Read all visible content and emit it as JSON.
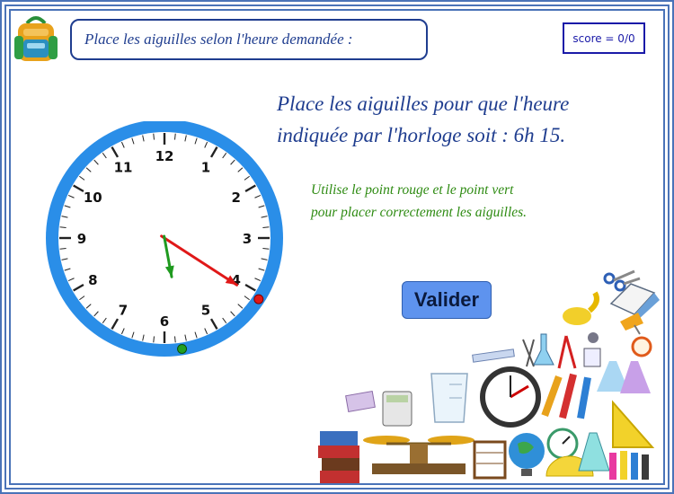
{
  "header": {
    "title": "Place les aiguilles selon l'heure demandée :",
    "score": "score = 0/0"
  },
  "task": {
    "instruction_line1": "Place les aiguilles pour que l'heure",
    "instruction_line2": "indiquée par l'horloge soit : 6h 15.",
    "hint_line1": "Utilise le point rouge et le point vert",
    "hint_line2": "pour placer correctement les aiguilles."
  },
  "validate_button": "Valider",
  "clock": {
    "numbers": [
      "12",
      "1",
      "2",
      "3",
      "4",
      "5",
      "6",
      "7",
      "8",
      "9",
      "10",
      "11"
    ],
    "hour_hand_time_hours": 5.65,
    "minute_hand_time_minutes": 20.5,
    "minute_handle_position_minutes": 20.5,
    "hour_handle_position_minutes": 28.5
  },
  "colors": {
    "frame": "#4a73b8",
    "title_text": "#1f3d8f",
    "score_border": "#1a1aa8",
    "hint_text": "#2e8b12",
    "button": "#5e93ee",
    "clock_ring": "#2a8ee8",
    "minute_hand": "#e01818",
    "hour_hand": "#1f9a1f"
  }
}
